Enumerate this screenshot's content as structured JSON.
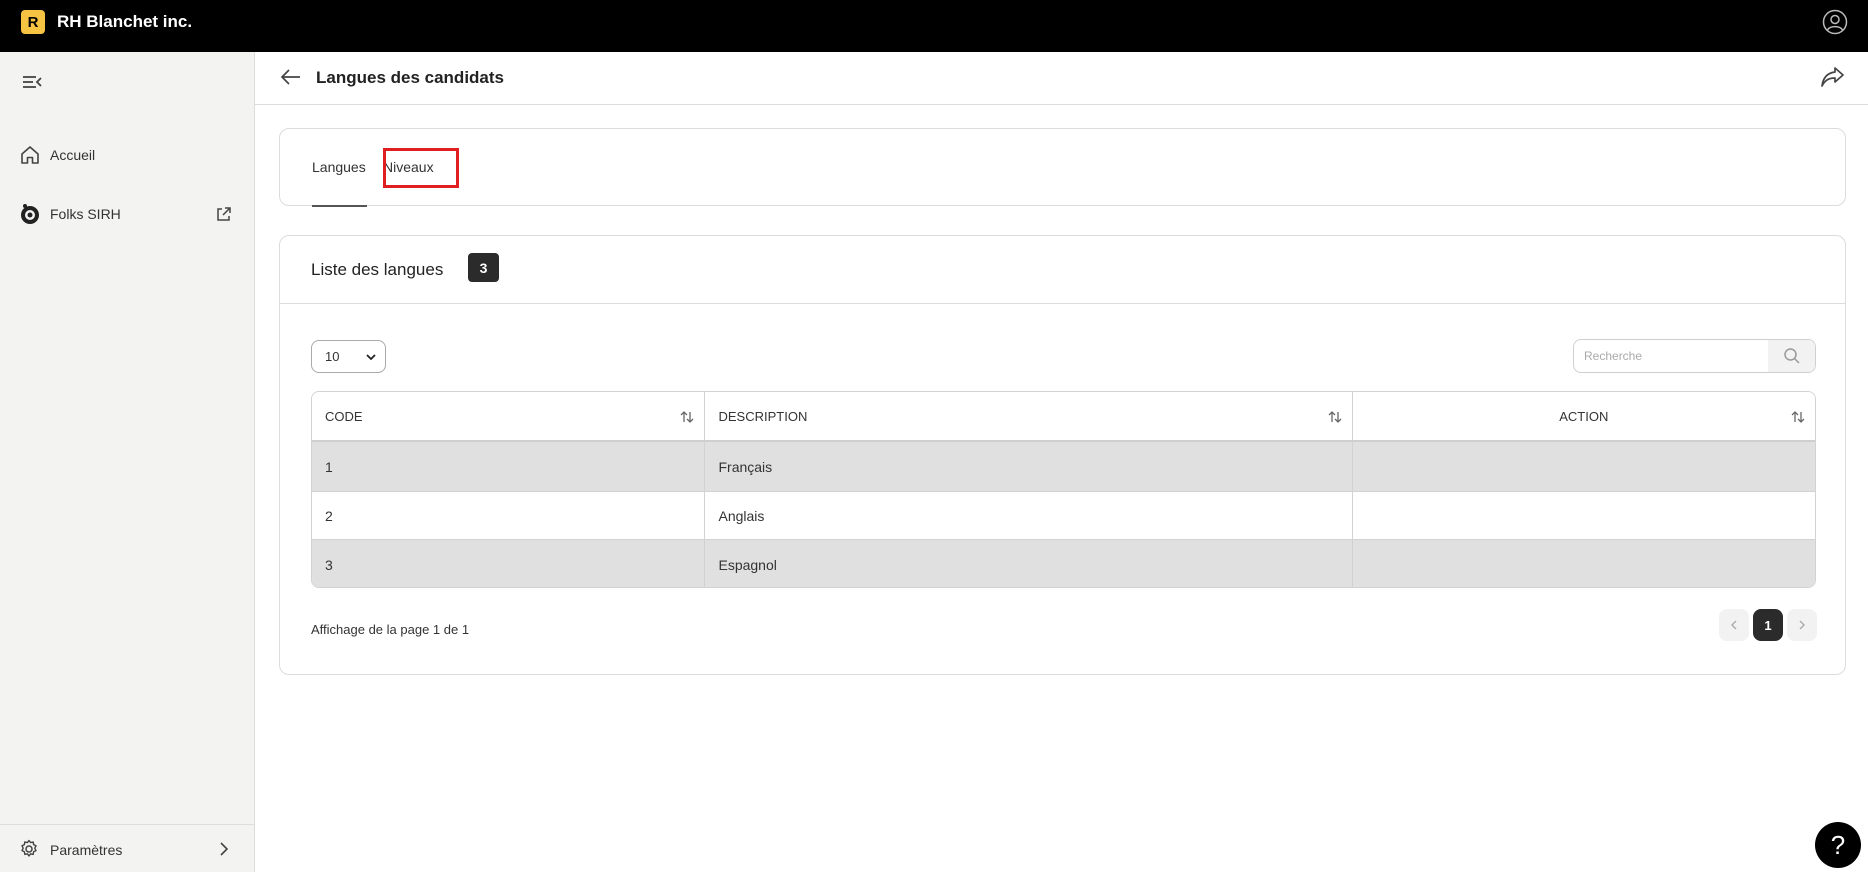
{
  "topbar": {
    "logo_letter": "R",
    "company_name": "RH Blanchet inc.",
    "logo_color": "#f6c343"
  },
  "sidebar": {
    "items": [
      {
        "label": "Accueil",
        "icon": "home-icon"
      },
      {
        "label": "Folks SIRH",
        "icon": "folks-logo-icon",
        "trailing_icon": "external-link-icon"
      }
    ],
    "bottom": {
      "label": "Paramètres",
      "icon": "gear-icon"
    }
  },
  "header": {
    "title": "Langues des candidats"
  },
  "tabs": [
    {
      "label": "Langues",
      "active": true
    },
    {
      "label": "Niveaux",
      "active": false,
      "highlighted": true
    }
  ],
  "list": {
    "title": "Liste des langues",
    "count": "3",
    "page_size": "10",
    "search_placeholder": "Recherche",
    "columns": [
      "CODE",
      "DESCRIPTION",
      "ACTION"
    ],
    "rows": [
      {
        "code": "1",
        "description": "Français",
        "action": ""
      },
      {
        "code": "2",
        "description": "Anglais",
        "action": ""
      },
      {
        "code": "3",
        "description": "Espagnol",
        "action": ""
      }
    ],
    "page_info": "Affichage de la page 1 de 1",
    "current_page": "1"
  },
  "help": {
    "label": "?"
  },
  "colors": {
    "topbar_bg": "#000000",
    "sidebar_bg": "#f3f3f2",
    "highlight": "#e02020",
    "stripe": "#e0e0e0"
  }
}
